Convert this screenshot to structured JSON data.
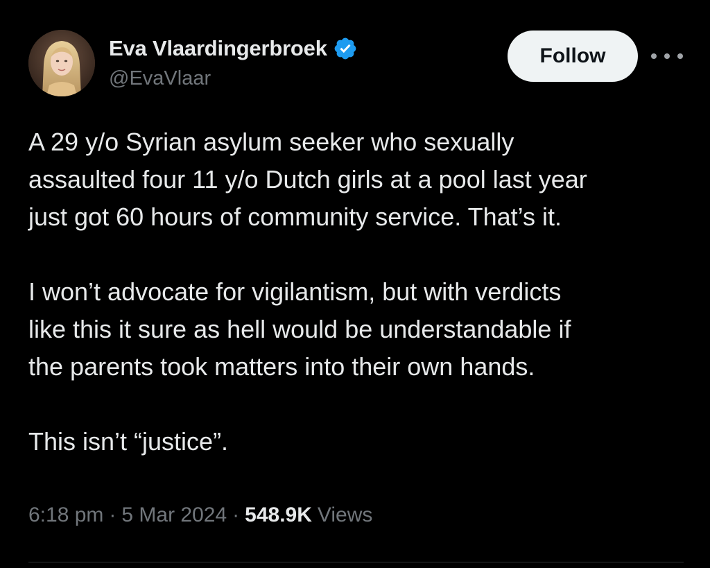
{
  "author": {
    "display_name": "Eva Vlaardingerbroek",
    "handle": "@EvaVlaar",
    "verified": true,
    "verified_color": "#1d9bf0",
    "avatar_icon": "profile-photo"
  },
  "actions": {
    "follow_label": "Follow",
    "more_icon": "ellipsis-horizontal-icon"
  },
  "tweet": {
    "lines_p1": [
      "A 29 y/o Syrian asylum seeker who sexually",
      "assaulted four 11 y/o Dutch girls at a pool last year",
      "just got 60 hours of community service. That’s it."
    ],
    "lines_p2": [
      "I won’t advocate for vigilantism, but with verdicts",
      "like this it sure as hell would be understandable if",
      "the parents took matters into their own hands."
    ],
    "lines_p3": [
      "This isn’t “justice”."
    ]
  },
  "meta": {
    "time": "6:18 pm",
    "date": "5 Mar 2024",
    "separator": "·",
    "views_count": "548.9K",
    "views_label": "Views"
  },
  "colors": {
    "background": "#000000",
    "text_primary": "#e7e9ea",
    "text_secondary": "#71767b",
    "follow_bg": "#eff3f4",
    "follow_text": "#0f1419"
  }
}
